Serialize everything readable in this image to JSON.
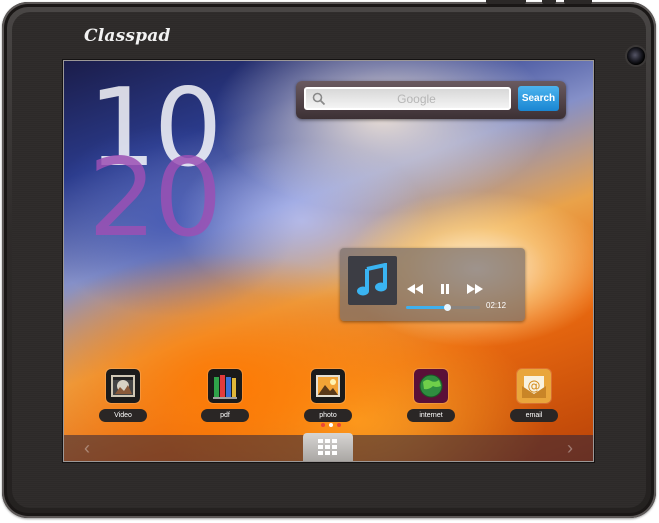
{
  "device": {
    "brand": "Classpad"
  },
  "clock": {
    "hour": "10",
    "minute": "20"
  },
  "search": {
    "placeholder": "Google",
    "button_label": "Search"
  },
  "music": {
    "time": "02:12",
    "progress": 0.55
  },
  "dock": {
    "apps": [
      {
        "label": "Video",
        "icon": "video-icon"
      },
      {
        "label": "pdf",
        "icon": "books-icon"
      },
      {
        "label": "photo",
        "icon": "photo-icon"
      },
      {
        "label": "internet",
        "icon": "globe-icon"
      },
      {
        "label": "email",
        "icon": "email-icon"
      }
    ]
  },
  "page_indicator": {
    "count": 3,
    "active": 1
  },
  "colors": {
    "accent": "#1a86d2",
    "clock_hour": "#ffffff",
    "clock_minute": "#9b50b4",
    "progress": "#3fb0ee"
  }
}
